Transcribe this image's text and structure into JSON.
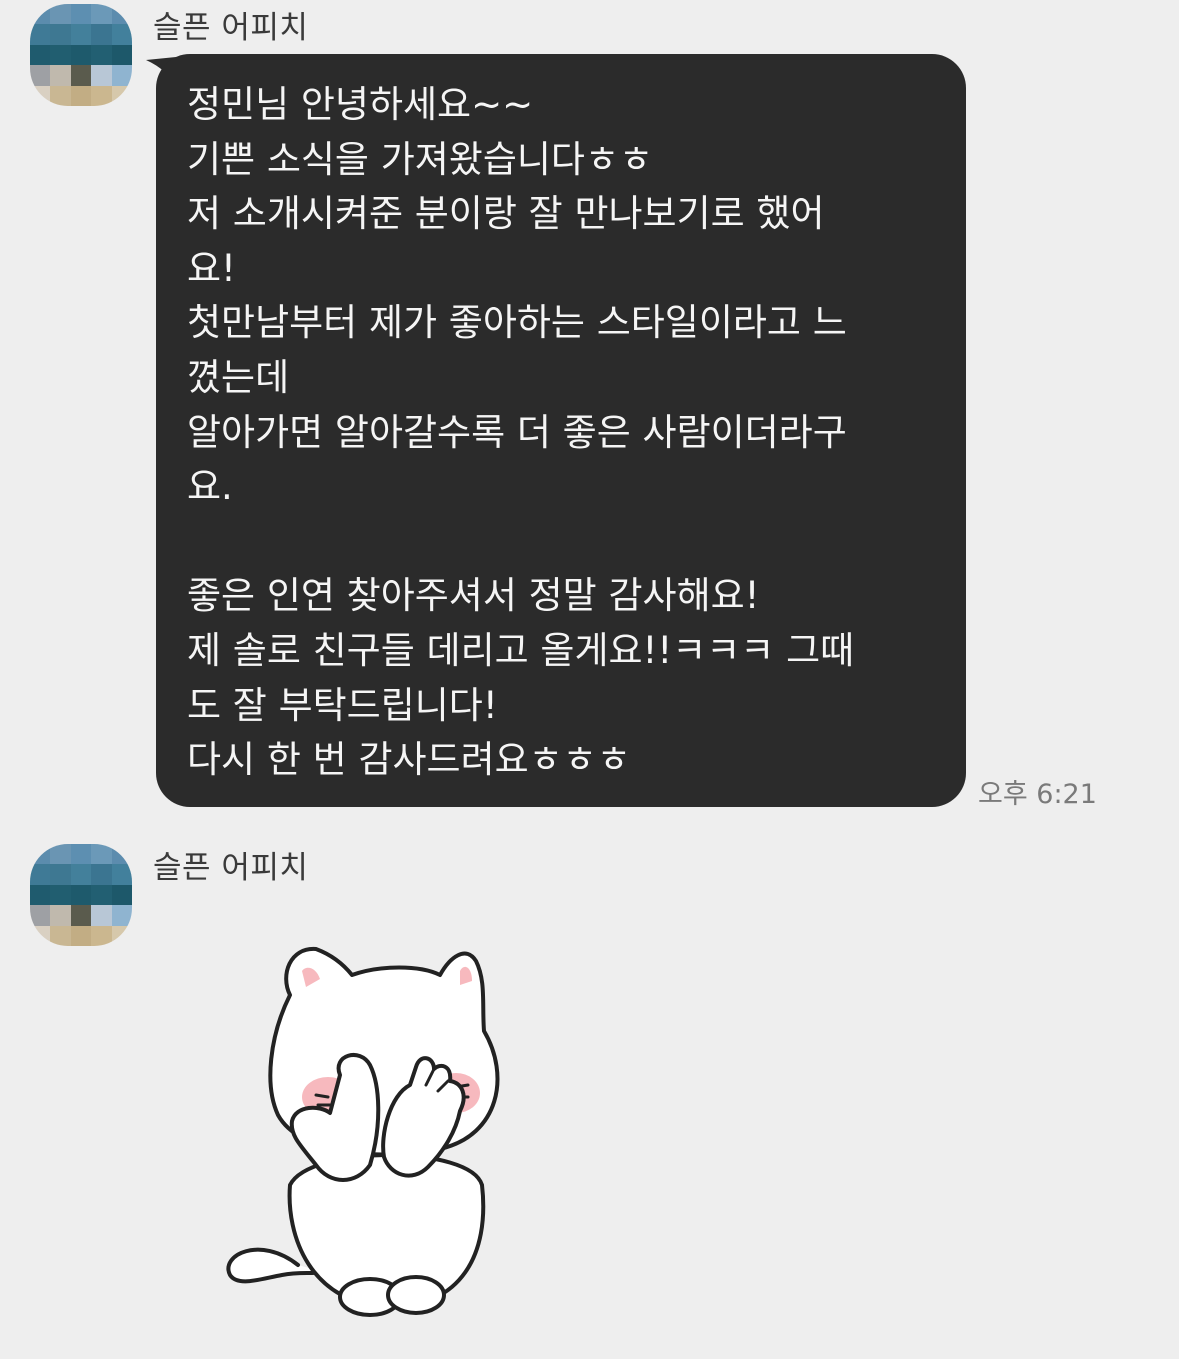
{
  "messages": [
    {
      "sender": "슬픈 어피치",
      "text": "정민님 안녕하세요~~\n기쁜 소식을 가져왔습니다ㅎㅎ\n저 소개시켜준 분이랑 잘 만나보기로 했어\n요!\n첫만남부터 제가 좋아하는 스타일이라고 느\n꼈는데\n알아가면 알아갈수록 더 좋은 사람이더라구\n요.\n\n좋은 인연 찾아주셔서 정말 감사해요!\n제 솔로 친구들 데리고 올게요!!ㅋㅋㅋ 그때\n도 잘 부탁드립니다!\n다시 한 번 감사드려요ㅎㅎㅎ",
      "time": "오후 6:21"
    },
    {
      "sender": "슬픈 어피치",
      "sticker": "white-cat-covering-face-sticker"
    }
  ],
  "colors": {
    "background": "#eeeeee",
    "bubble": "#2b2b2b",
    "bubble_text": "#f5f5f5",
    "sender_text": "#3a3a3a",
    "time_text": "#7a7a7a",
    "cat_blush": "#f7b9be"
  }
}
